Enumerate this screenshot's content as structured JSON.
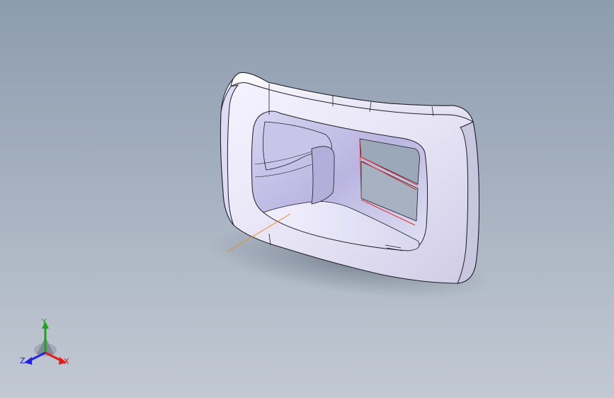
{
  "viewport": {
    "background_top": "#8d9caf",
    "background_bottom": "#c2c9d3",
    "part_color": "#eceaf8",
    "edge_color": "#1c1c24",
    "highlight_edge_color": "#e0322a",
    "sketch_line_color": "#f08a1e"
  },
  "triad": {
    "x_label": "X",
    "y_label": "Y",
    "z_label": "Z",
    "x_color": "#e21a1a",
    "y_color": "#1fa31f",
    "z_color": "#2222dd"
  }
}
